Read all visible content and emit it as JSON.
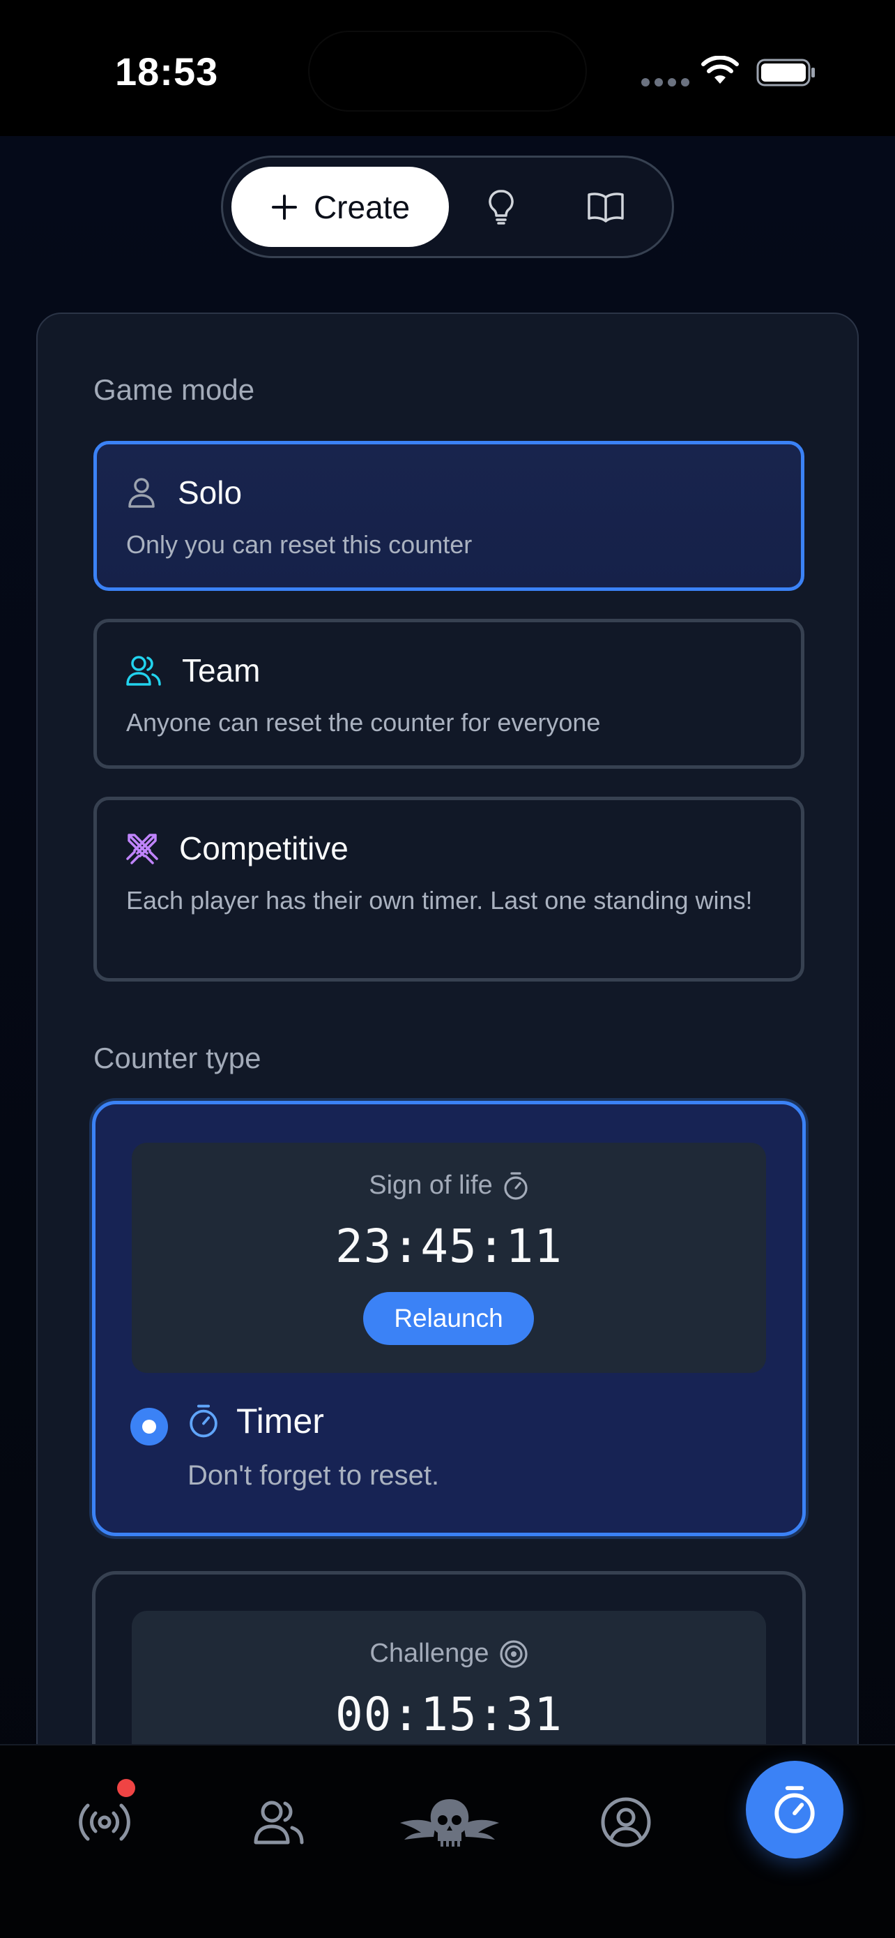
{
  "status_bar": {
    "time": "18:53"
  },
  "toolbar": {
    "create_label": "Create",
    "icons": [
      "plus-icon",
      "lightbulb-icon",
      "book-open-icon"
    ]
  },
  "game_mode": {
    "section_label": "Game mode",
    "options": [
      {
        "title": "Solo",
        "description": "Only you can reset this counter",
        "icon": "user-icon",
        "icon_color": "#9ca3af",
        "selected": true
      },
      {
        "title": "Team",
        "description": "Anyone can reset the counter for everyone",
        "icon": "users-icon",
        "icon_color": "#22d3ee",
        "selected": false
      },
      {
        "title": "Competitive",
        "description": "Each player has their own timer. Last one standing wins!",
        "icon": "swords-icon",
        "icon_color": "#c084fc",
        "selected": false
      }
    ]
  },
  "counter_type": {
    "section_label": "Counter type",
    "options": [
      {
        "preview_label": "Sign of life",
        "preview_icon": "stopwatch-icon",
        "preview_time": "23:45:11",
        "action_label": "Relaunch",
        "title": "Timer",
        "title_icon": "stopwatch-icon",
        "description": "Don't forget to reset.",
        "selected": true
      },
      {
        "preview_label": "Challenge",
        "preview_icon": "target-icon",
        "preview_time": "00:15:31",
        "selected": false
      }
    ]
  },
  "bottom_nav": {
    "items": [
      "broadcast-icon",
      "users-icon",
      "skull-wings-icon",
      "user-circle-icon",
      "stopwatch-icon"
    ],
    "notification": true
  },
  "colors": {
    "accent": "#3b82f6",
    "background": "#050a1a",
    "card": "#111827",
    "selected_card": "#172554",
    "notification": "#ef4444"
  }
}
